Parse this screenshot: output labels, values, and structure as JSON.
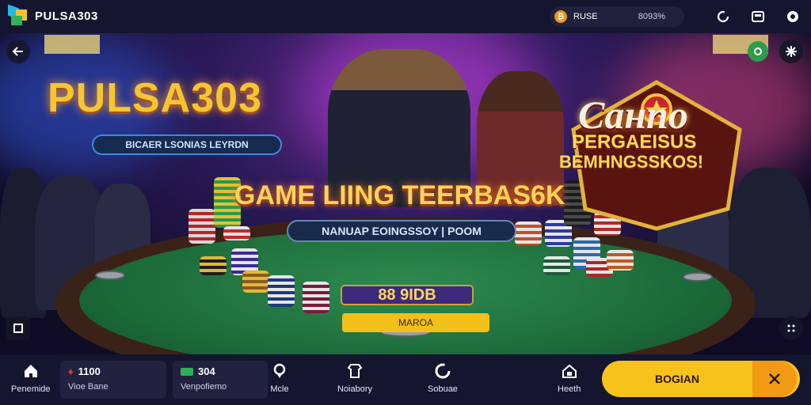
{
  "header": {
    "brand_name": "PULSA303",
    "brand_tagline": "",
    "coin_symbol": "₿",
    "balance_label": "RUSE",
    "balance_value": "8093%",
    "icons": [
      "refresh-icon",
      "window-icon",
      "settings-gear-icon"
    ]
  },
  "banner": {
    "hero_title": "PULSA303",
    "hero_subtitle": "BICAER LSONIAS LEYRDN",
    "game_title": "GAME LIING TEERBAS6K",
    "game_subtitle": "NANUAP EOINGSSOY | POOM",
    "casino_word": "Caнno",
    "casino_line1": "PERGAEISUS",
    "casino_line2": "BEMHNGSSKOS!",
    "code_value": "88 9IDB",
    "cta_label": "MAROA",
    "buttons": [
      "back-arrow-icon",
      "green-badge-icon",
      "close-star-icon",
      "exit-icon",
      "expand-icon"
    ]
  },
  "bottom_nav": {
    "items": [
      {
        "label": "Penemide",
        "icon": "home-icon"
      },
      {
        "label": "Mcle",
        "icon": "location-pin-icon"
      },
      {
        "label": "Noiabory",
        "icon": "shirt-icon"
      },
      {
        "label": "Sobuae",
        "icon": "refresh-circle-icon"
      },
      {
        "label": "Heeth",
        "icon": "house-image-icon"
      }
    ],
    "wallet1": {
      "value": "1100",
      "label": "Vioe Bane"
    },
    "wallet2": {
      "value": "304",
      "label": "Venpofiemo"
    },
    "primary_button": {
      "label": "BOGIAN",
      "icon": "scissors-icon"
    }
  },
  "colors": {
    "accent_yellow": "#f7c21c",
    "accent_orange": "#f29a14",
    "felt_green": "#1c6b3a",
    "nav_bg": "#14152e"
  }
}
